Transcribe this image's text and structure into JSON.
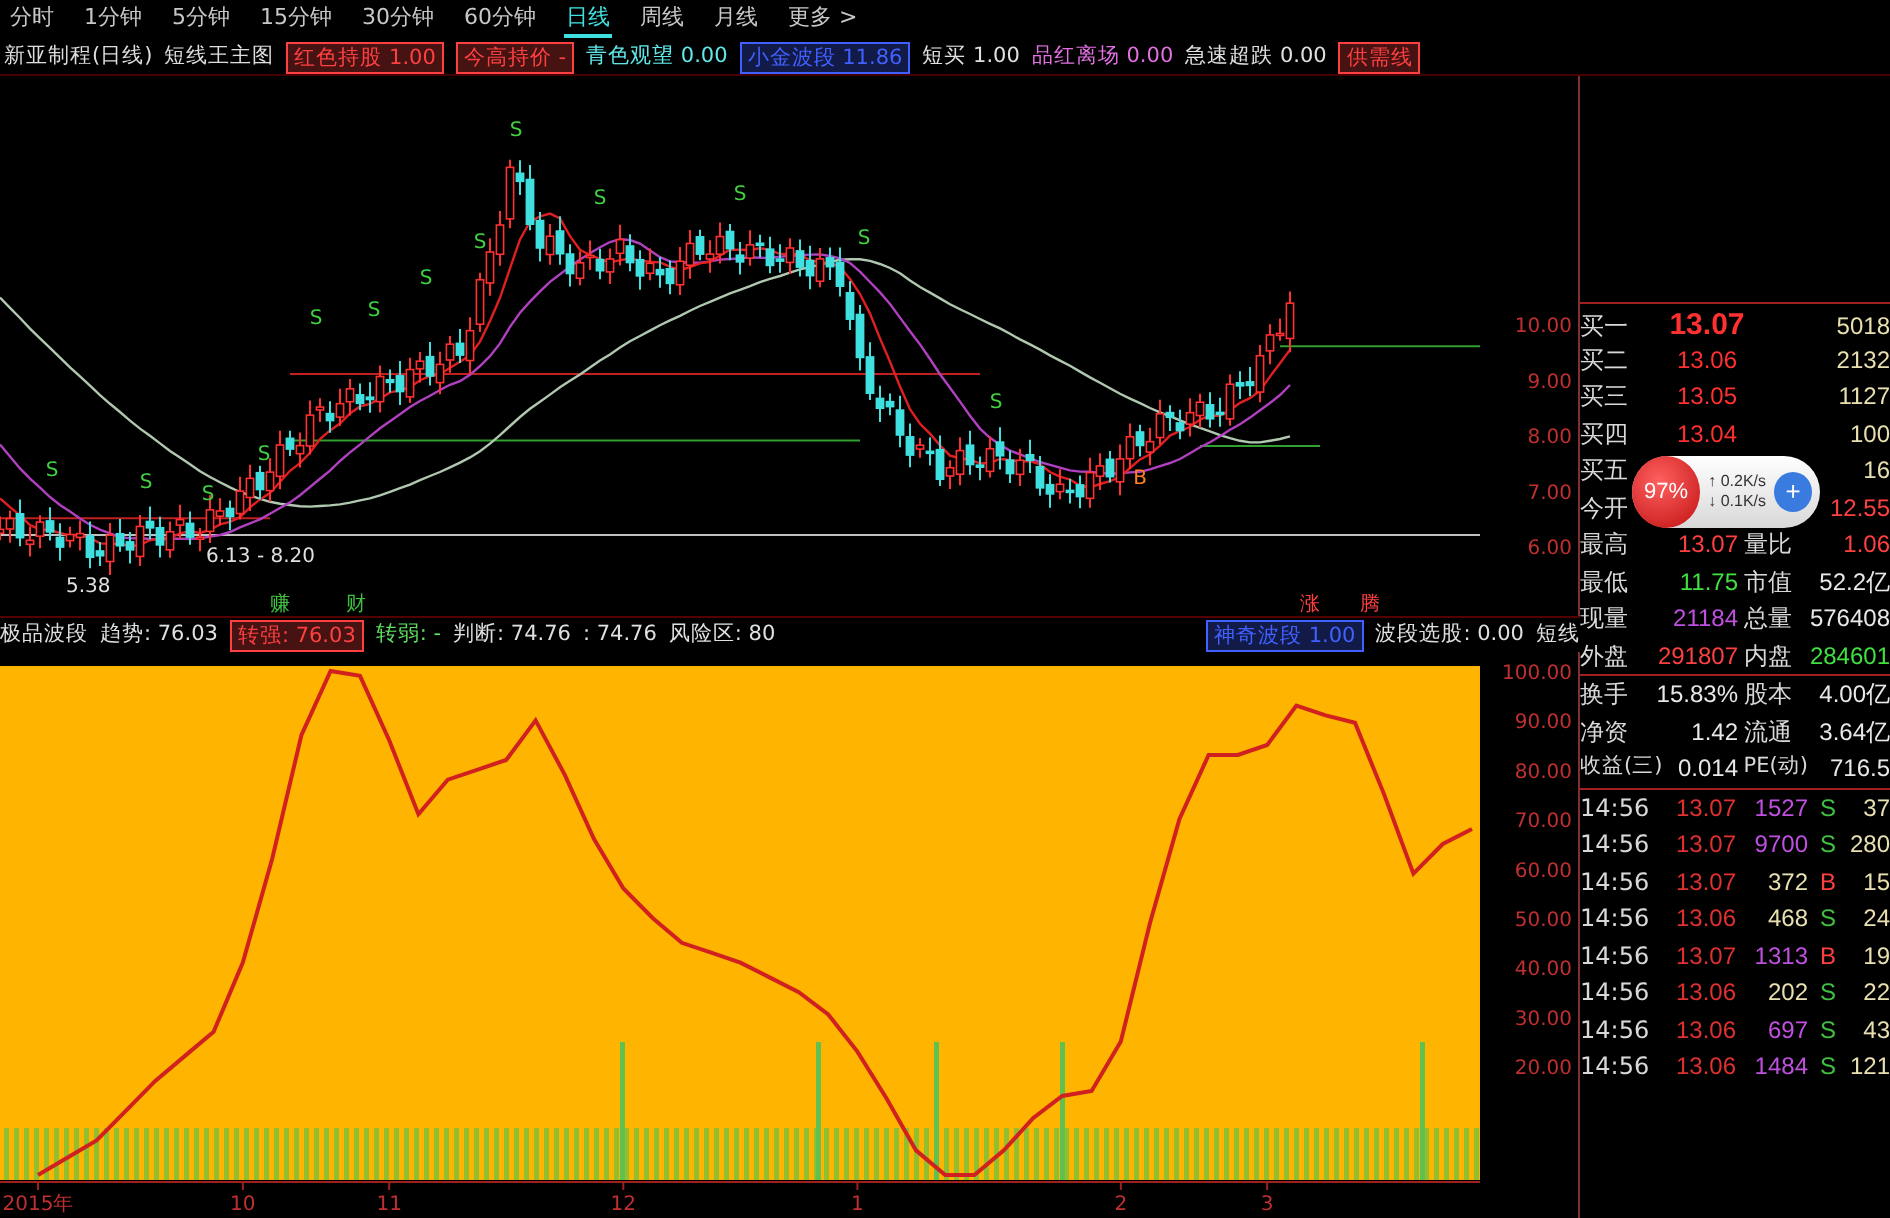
{
  "period_tabs": [
    {
      "label": "分时",
      "selected": false
    },
    {
      "label": "1分钟",
      "selected": false
    },
    {
      "label": "5分钟",
      "selected": false
    },
    {
      "label": "15分钟",
      "selected": false
    },
    {
      "label": "30分钟",
      "selected": false
    },
    {
      "label": "60分钟",
      "selected": false
    },
    {
      "label": "日线",
      "selected": true
    },
    {
      "label": "周线",
      "selected": false
    },
    {
      "label": "月线",
      "selected": false
    },
    {
      "label": "更多 >",
      "selected": false
    }
  ],
  "indicator_bar": {
    "stock": "新亚制程(日线)",
    "formula": "短线王主图",
    "items": [
      {
        "text": "红色持股 1.00",
        "color": "#ff4040",
        "boxed": true
      },
      {
        "text": "今高持价 -",
        "color": "#ff4040",
        "boxed": true
      },
      {
        "text": "青色观望 0.00",
        "color": "#60e8e8",
        "boxed": false
      },
      {
        "text": "小金波段 11.86",
        "color": "#4060ff",
        "boxed": true
      },
      {
        "text": "短买 1.00",
        "color": "#e0e0e0",
        "boxed": false
      },
      {
        "text": "品红离场 0.00",
        "color": "#e070e0",
        "boxed": false
      },
      {
        "text": "急速超跌 0.00",
        "color": "#e0e0e0",
        "boxed": false
      },
      {
        "text": "供需线",
        "color": "#ff4040",
        "boxed": true
      }
    ]
  },
  "main_chart": {
    "price_ticks": [
      "10.00",
      "9.00",
      "8.00",
      "7.00",
      "6.00"
    ],
    "signals": [
      {
        "text": "S",
        "kind": "sell"
      },
      {
        "text": "S",
        "kind": "sell"
      },
      {
        "text": "S",
        "kind": "sell"
      },
      {
        "text": "S",
        "kind": "sell"
      },
      {
        "text": "S",
        "kind": "sell"
      },
      {
        "text": "S",
        "kind": "sell"
      },
      {
        "text": "S",
        "kind": "sell"
      },
      {
        "text": "S",
        "kind": "sell"
      },
      {
        "text": "S",
        "kind": "sell"
      },
      {
        "text": "S",
        "kind": "sell"
      },
      {
        "text": "S",
        "kind": "sell"
      },
      {
        "text": "S",
        "kind": "sell"
      },
      {
        "text": "S",
        "kind": "sell"
      },
      {
        "text": "B",
        "kind": "buy"
      }
    ],
    "low_label": "5.38",
    "range_label": "6.13 - 8.20",
    "bottom_marks": [
      {
        "text": "赚",
        "color": "#40c040"
      },
      {
        "text": "财",
        "color": "#40c040"
      },
      {
        "text": "涨",
        "color": "#ff4040"
      },
      {
        "text": "腾",
        "color": "#ff4040"
      }
    ]
  },
  "lower_header": {
    "title": "极品波段",
    "items": [
      {
        "text": "趋势: 76.03",
        "color": "#e0e0e0",
        "boxed": false
      },
      {
        "text": "转强: 76.03",
        "color": "#ff4040",
        "boxed": true
      },
      {
        "text": "转弱: -",
        "color": "#60e060",
        "boxed": false
      },
      {
        "text": "判断: 74.76",
        "color": "#e0e0e0",
        "boxed": false
      },
      {
        "text": ": 74.76",
        "color": "#e0e0e0",
        "boxed": false
      },
      {
        "text": "风险区: 80",
        "color": "#e0e0e0",
        "boxed": false
      }
    ],
    "right_items": [
      {
        "text": "神奇波段 1.00",
        "color": "#4060ff",
        "boxed": true
      },
      {
        "text": "波段选股: 0.00",
        "color": "#e0e0e0",
        "boxed": false
      },
      {
        "text": "短线",
        "color": "#e0e0e0",
        "boxed": false
      }
    ]
  },
  "oscillator": {
    "chart_data": {
      "type": "line",
      "ylim": [
        -3,
        101
      ],
      "categories": [
        "2015年",
        null,
        null,
        null,
        null,
        null,
        null,
        "10",
        null,
        null,
        null,
        null,
        "11",
        null,
        null,
        null,
        null,
        null,
        null,
        null,
        "12",
        null,
        null,
        null,
        null,
        null,
        null,
        null,
        "1",
        null,
        null,
        null,
        null,
        null,
        null,
        null,
        null,
        "2",
        null,
        null,
        null,
        null,
        "3",
        null,
        null,
        null,
        null,
        null,
        null,
        null
      ],
      "yticks": [
        {
          "value": 100,
          "label": "100.00"
        },
        {
          "value": 90,
          "label": "90.00"
        },
        {
          "value": 80,
          "label": "80.00"
        },
        {
          "value": 70,
          "label": "70.00"
        },
        {
          "value": 60,
          "label": "60.00"
        },
        {
          "value": 50,
          "label": "50.00"
        },
        {
          "value": 40,
          "label": "40.00"
        },
        {
          "value": 30,
          "label": "30.00"
        },
        {
          "value": 20,
          "label": "20.00"
        }
      ],
      "series": [
        {
          "color": "#d02020",
          "values": [
            -2,
            1.5,
            5,
            11,
            17,
            22,
            27,
            41,
            62,
            87,
            100,
            99,
            86,
            71,
            78,
            80,
            82,
            90,
            79,
            66,
            56,
            50,
            45,
            43,
            41,
            38,
            35,
            30.5,
            23,
            13.5,
            3,
            -2,
            -2,
            3,
            9.5,
            14,
            15,
            25,
            49,
            70,
            83,
            83,
            85,
            93,
            91,
            89.5,
            75,
            59,
            65,
            68
          ]
        }
      ]
    }
  },
  "quote": {
    "book": [
      {
        "label": "买一",
        "price": "13.07",
        "volume": "5018"
      },
      {
        "label": "买二",
        "price": "13.06",
        "volume": "2132"
      },
      {
        "label": "买三",
        "price": "13.05",
        "volume": "1127"
      },
      {
        "label": "买四",
        "price": "13.04",
        "volume": "100"
      },
      {
        "label": "买五",
        "volume": "16"
      }
    ],
    "stats": [
      {
        "label": "今开",
        "value2": {
          "text": "12.55",
          "color": "#ff4040"
        }
      },
      {
        "label": "最高",
        "value": {
          "text": "13.07",
          "color": "#ff4040"
        },
        "label2": "量比",
        "value2": {
          "text": "1.06",
          "color": "#ff4040"
        }
      },
      {
        "label": "最低",
        "value": {
          "text": "11.75",
          "color": "#40e040"
        },
        "label2": "市值",
        "value2": {
          "text": "52.2亿",
          "color": "#e8e8e8"
        }
      },
      {
        "label": "现量",
        "value": {
          "text": "21184",
          "color": "#c050e0"
        },
        "label2": "总量",
        "value2": {
          "text": "576408",
          "color": "#e8e8e8"
        }
      },
      {
        "label": "外盘",
        "value": {
          "text": "291807",
          "color": "#ff4040"
        },
        "label2": "内盘",
        "value2": {
          "text": "284601",
          "color": "#40e040"
        }
      },
      {
        "label": "换手",
        "value": {
          "text": "15.83%",
          "color": "#e8e8e8"
        },
        "label2": "股本",
        "value2": {
          "text": "4.00亿",
          "color": "#e8e8e8"
        }
      },
      {
        "label": "净资",
        "value": {
          "text": "1.42",
          "color": "#e8e8e8"
        },
        "label2": "流通",
        "value2": {
          "text": "3.64亿",
          "color": "#e8e8e8"
        }
      },
      {
        "label": "收益(三)",
        "value": {
          "text": "0.014",
          "color": "#e8e8e8"
        },
        "label2": "PE(动)",
        "value2": {
          "text": "716.5",
          "color": "#e8e8e8"
        }
      }
    ],
    "trades": [
      {
        "time": "14:56",
        "price": "13.07",
        "volume": {
          "text": "1527",
          "color": "#c050e0"
        },
        "side": {
          "text": "S",
          "color": "#40c040"
        },
        "count": "37"
      },
      {
        "time": "14:56",
        "price": "13.07",
        "volume": {
          "text": "9700",
          "color": "#c050e0"
        },
        "side": {
          "text": "S",
          "color": "#40c040"
        },
        "count": "280"
      },
      {
        "time": "14:56",
        "price": "13.07",
        "volume": {
          "text": "372",
          "color": "#e8e0b0"
        },
        "side": {
          "text": "B",
          "color": "#ff4040"
        },
        "count": "15"
      },
      {
        "time": "14:56",
        "price": "13.06",
        "volume": {
          "text": "468",
          "color": "#e8e0b0"
        },
        "side": {
          "text": "S",
          "color": "#40c040"
        },
        "count": "24"
      },
      {
        "time": "14:56",
        "price": "13.07",
        "volume": {
          "text": "1313",
          "color": "#c050e0"
        },
        "side": {
          "text": "B",
          "color": "#ff4040"
        },
        "count": "19"
      },
      {
        "time": "14:56",
        "price": "13.06",
        "volume": {
          "text": "202",
          "color": "#e8e0b0"
        },
        "side": {
          "text": "S",
          "color": "#40c040"
        },
        "count": "22"
      },
      {
        "time": "14:56",
        "price": "13.06",
        "volume": {
          "text": "697",
          "color": "#c050e0"
        },
        "side": {
          "text": "S",
          "color": "#40c040"
        },
        "count": "43"
      },
      {
        "time": "14:56",
        "price": "13.06",
        "volume": {
          "text": "1484",
          "color": "#c050e0"
        },
        "side": {
          "text": "S",
          "color": "#40c040"
        },
        "count": "121"
      }
    ]
  },
  "speed_widget": {
    "percent": "97%",
    "up_arrow": "↑",
    "up": "0.2K/s",
    "down_arrow": "↓",
    "down": "0.1K/s",
    "button": "+"
  }
}
